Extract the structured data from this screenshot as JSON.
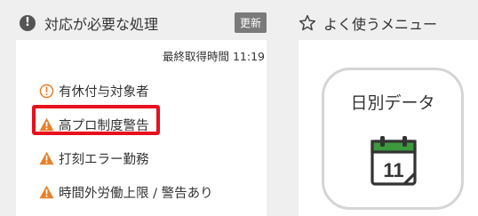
{
  "left_panel": {
    "title": "対応が必要な処理",
    "refresh_label": "更新",
    "last_fetch": "最終取得時間 11:19",
    "items": [
      {
        "label": "有休付与対象者",
        "icon": "info-circle-icon",
        "color": "#e8812b"
      },
      {
        "label": "高プロ制度警告",
        "icon": "warning-icon",
        "color": "#e8812b",
        "highlighted": true
      },
      {
        "label": "打刻エラー勤務",
        "icon": "warning-icon",
        "color": "#e8812b"
      },
      {
        "label": "時間外労働上限 / 警告あり",
        "icon": "warning-icon",
        "color": "#e8812b"
      }
    ]
  },
  "right_panel": {
    "title": "よく使うメニュー",
    "tiles": [
      {
        "label": "日別データ",
        "icon": "calendar-icon",
        "icon_text": "11"
      }
    ]
  },
  "colors": {
    "highlight_border": "#e8101d",
    "calendar_green": "#3b9a3e",
    "warning_orange": "#e8812b"
  }
}
